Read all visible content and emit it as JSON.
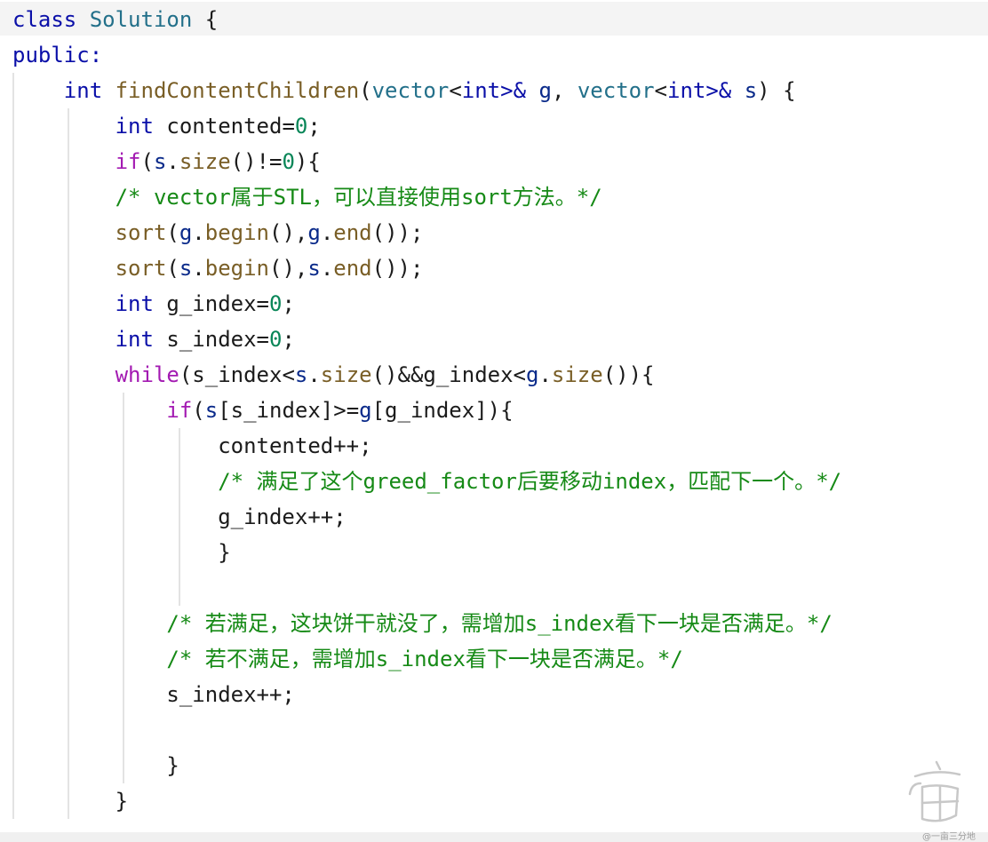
{
  "editor": {
    "lines": {
      "l1": {
        "kw": "class",
        "sp": " ",
        "cls": "Solution",
        "rest": " {"
      },
      "l2": {
        "kw": "public:"
      },
      "l3": {
        "ind": "    ",
        "ret": "int",
        "sp": " ",
        "fn": "findContentChildren",
        "p1": "(",
        "t1": "vector",
        "lt1": "<",
        "i1": "int",
        "gt1": ">& ",
        "a1": "g",
        "c1": ", ",
        "t2": "vector",
        "lt2": "<",
        "i2": "int",
        "gt2": ">& ",
        "a2": "s",
        "end": ") {"
      },
      "l4": {
        "ind": "        ",
        "ty": "int",
        "rest": " contented=",
        "num": "0",
        "end": ";"
      },
      "l5": {
        "ind": "        ",
        "kw": "if",
        "p": "(",
        "v": "s",
        "dot": ".",
        "fn": "size",
        "mid": "()!=",
        "num": "0",
        "end": "){"
      },
      "l6": {
        "ind": "        ",
        "a": "/* vector",
        "cn1": "属于",
        "b": "STL",
        "cn2": "，可以直接使用",
        "c": "sort",
        "cn3": "方法。",
        "end": "*/"
      },
      "l7": {
        "ind": "        ",
        "fn": "sort",
        "p": "(",
        "v1": "g",
        "d1": ".",
        "f1": "begin",
        "m1": "(),",
        "v2": "g",
        "d2": ".",
        "f2": "end",
        "end": "());"
      },
      "l8": {
        "ind": "        ",
        "fn": "sort",
        "p": "(",
        "v1": "s",
        "d1": ".",
        "f1": "begin",
        "m1": "(),",
        "v2": "s",
        "d2": ".",
        "f2": "end",
        "end": "());"
      },
      "l9": {
        "ind": "        ",
        "ty": "int",
        "rest": " g_index=",
        "num": "0",
        "end": ";"
      },
      "l10": {
        "ind": "        ",
        "ty": "int",
        "rest": " s_index=",
        "num": "0",
        "end": ";"
      },
      "l11": {
        "ind": "        ",
        "kw": "while",
        "a": "(s_index<",
        "v1": "s",
        "d1": ".",
        "f1": "size",
        "b": "()&&g_index<",
        "v2": "g",
        "d2": ".",
        "f2": "size",
        "end": "()){"
      },
      "l12": {
        "ind": "            ",
        "kw": "if",
        "a": "(",
        "v1": "s",
        "b": "[s_index]>=",
        "v2": "g",
        "end": "[g_index]){"
      },
      "l13": {
        "ind": "                ",
        "text": "contented++;"
      },
      "l14": {
        "ind": "                ",
        "a": "/* ",
        "cn1": "满足了这个",
        "b": "greed_factor",
        "cn2": "后要移动",
        "c": "index",
        "cn3": "，匹配下一个。",
        "end": "*/"
      },
      "l15": {
        "ind": "                ",
        "text": "g_index++;"
      },
      "l16": {
        "ind": "                ",
        "text": "}"
      },
      "l18": {
        "ind": "            ",
        "a": "/* ",
        "cn1": "若满足，这块饼干就没了，需增加",
        "b": "s_index",
        "cn2": "看下一块是否满足。",
        "end": "*/"
      },
      "l19": {
        "ind": "            ",
        "a": "/* ",
        "cn1": "若不满足，需增加",
        "b": "s_index",
        "cn2": "看下一块是否满足。",
        "end": "*/"
      },
      "l20": {
        "ind": "            ",
        "text": "s_index++;"
      },
      "l22": {
        "ind": "            ",
        "text": "}"
      },
      "l23": {
        "ind": "        ",
        "text": "}"
      }
    }
  },
  "watermark": {
    "text": "@一亩三分地"
  }
}
